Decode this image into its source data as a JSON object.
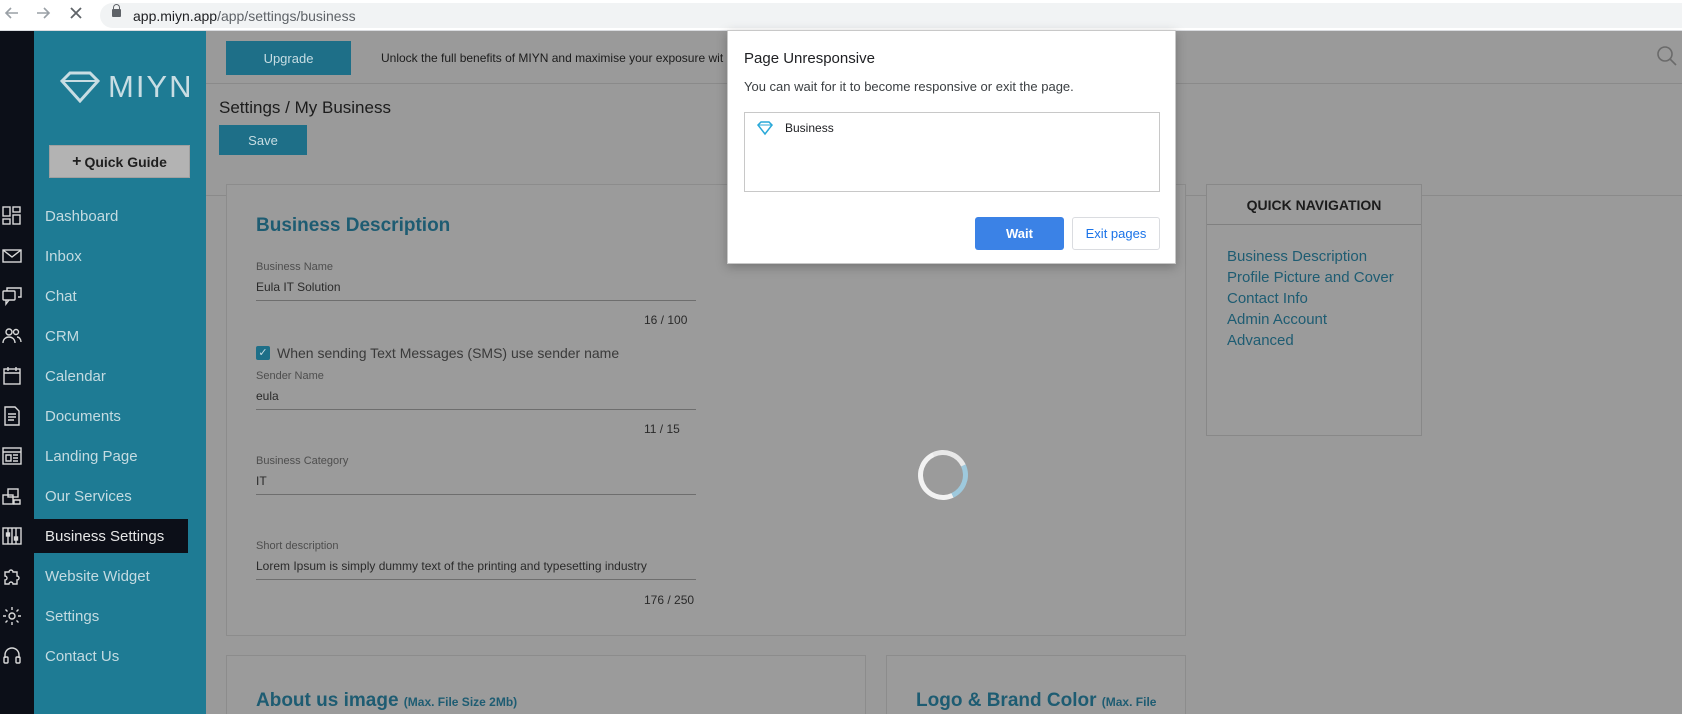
{
  "browser": {
    "url_host": "app.miyn.app",
    "url_path": "/app/settings/business",
    "back_icon": "arrow-left",
    "forward_icon": "arrow-right",
    "stop_icon": "close-x"
  },
  "sidebar": {
    "logo_text": "MIYN",
    "quick_guide_label": "Quick Guide",
    "items": [
      {
        "label": "Dashboard",
        "icon": "dashboard"
      },
      {
        "label": "Inbox",
        "icon": "envelope"
      },
      {
        "label": "Chat",
        "icon": "chat-bubbles"
      },
      {
        "label": "CRM",
        "icon": "people"
      },
      {
        "label": "Calendar",
        "icon": "calendar"
      },
      {
        "label": "Documents",
        "icon": "document"
      },
      {
        "label": "Landing Page",
        "icon": "layout"
      },
      {
        "label": "Our Services",
        "icon": "services"
      },
      {
        "label": "Business Settings",
        "icon": "sliders",
        "active": true
      },
      {
        "label": "Website Widget",
        "icon": "puzzle"
      },
      {
        "label": "Settings",
        "icon": "gear"
      },
      {
        "label": "Contact Us",
        "icon": "headset"
      }
    ]
  },
  "topbar": {
    "upgrade_label": "Upgrade",
    "upgrade_text": "Unlock the full benefits of MIYN and maximise your exposure wit"
  },
  "header": {
    "page_title": "Settings / My Business",
    "save_label": "Save"
  },
  "business": {
    "section_title": "Business Description",
    "business_name_label": "Business Name",
    "business_name_value": "Eula IT Solution",
    "business_name_counter": "16 / 100",
    "sms_checkbox_label": "When sending Text Messages (SMS) use sender name",
    "sms_checked": true,
    "sender_name_label": "Sender Name",
    "sender_name_value": "eula",
    "sender_name_counter": "11 / 15",
    "category_label": "Business Category",
    "category_value": "IT",
    "short_desc_label": "Short description",
    "short_desc_value": "Lorem Ipsum is simply dummy text of the printing and typesetting industry",
    "short_desc_counter": "176 / 250"
  },
  "about_image": {
    "title": "About us image",
    "note": "(Max. File Size 2Mb)"
  },
  "logo_brand": {
    "title": "Logo & Brand Color",
    "note": "(Max. File"
  },
  "quick_nav": {
    "title": "QUICK NAVIGATION",
    "links": [
      "Business Description",
      "Profile Picture and Cover",
      "Contact Info",
      "Admin Account",
      "Advanced"
    ]
  },
  "dialog": {
    "title": "Page Unresponsive",
    "message": "You can wait for it to become responsive or exit the page.",
    "pages": [
      "Business"
    ],
    "wait_label": "Wait",
    "exit_label": "Exit pages"
  },
  "colors": {
    "sidebar": "#1e7b94",
    "accent_button": "#1e6f88",
    "dialog_primary": "#3b82e6"
  }
}
